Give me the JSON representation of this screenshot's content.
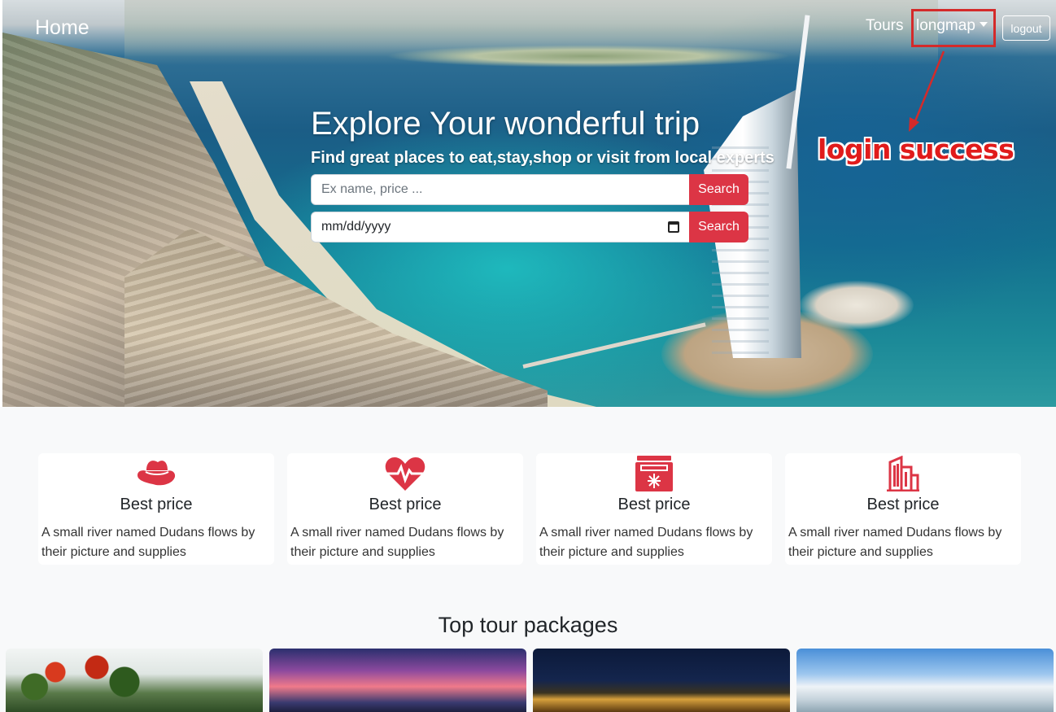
{
  "nav": {
    "home": "Home",
    "tours": "Tours",
    "username": "longmap",
    "logout": "logout"
  },
  "annotation": {
    "text": "login success",
    "color": "#e01b1b"
  },
  "hero": {
    "title": "Explore Your wonderful trip",
    "subtitle": "Find great places to eat,stay,shop or visit from local experts",
    "search_placeholder": "Ex name, price ...",
    "date_value": "mm/dd/yyyy",
    "search_label": "Search",
    "accent": "#dc3545"
  },
  "features": [
    {
      "icon": "hat-icon",
      "title": "Best price",
      "text": "A small river named Dudans flows by their picture and supplies"
    },
    {
      "icon": "heart-pulse-icon",
      "title": "Best price",
      "text": "A small river named Dudans flows by their picture and supplies"
    },
    {
      "icon": "freezer-icon",
      "title": "Best price",
      "text": "A small river named Dudans flows by their picture and supplies"
    },
    {
      "icon": "building-icon",
      "title": "Best price",
      "text": "A small river named Dudans flows by their picture and supplies"
    }
  ],
  "packages": {
    "title": "Top tour packages"
  }
}
